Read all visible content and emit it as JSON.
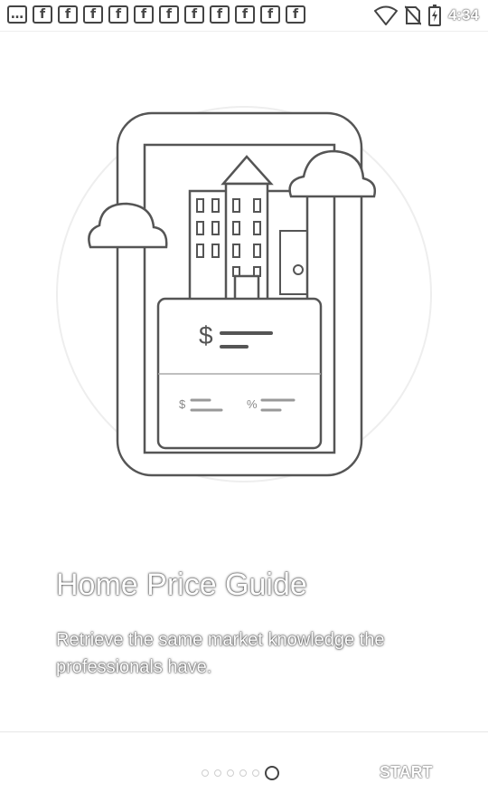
{
  "status_bar": {
    "time": "4:34",
    "notifications": [
      {
        "icon": "message-icon",
        "glyph": "…"
      },
      {
        "icon": "facebook-icon",
        "glyph": "f"
      },
      {
        "icon": "facebook-icon",
        "glyph": "f"
      },
      {
        "icon": "facebook-icon",
        "glyph": "f"
      },
      {
        "icon": "facebook-icon",
        "glyph": "f"
      },
      {
        "icon": "facebook-icon",
        "glyph": "f"
      },
      {
        "icon": "facebook-icon",
        "glyph": "f"
      },
      {
        "icon": "facebook-icon",
        "glyph": "f"
      },
      {
        "icon": "facebook-icon",
        "glyph": "f"
      },
      {
        "icon": "facebook-icon",
        "glyph": "f"
      },
      {
        "icon": "facebook-icon",
        "glyph": "f"
      },
      {
        "icon": "facebook-icon",
        "glyph": "f"
      }
    ],
    "system_icons": [
      "wifi-icon",
      "no-sim-icon",
      "battery-icon"
    ]
  },
  "illustration": {
    "dollar_symbol": "$",
    "small_dollar_symbol": "$",
    "percent_symbol": "%"
  },
  "onboarding": {
    "title": "Home Price Guide",
    "description": "Retrieve the same market knowledge the professionals have."
  },
  "pager": {
    "page_count": 6,
    "current_index": 5
  },
  "footer": {
    "start_label": "START"
  },
  "colors": {
    "background": "#ffffff",
    "line_art": "#555555",
    "outline": "#444444"
  }
}
